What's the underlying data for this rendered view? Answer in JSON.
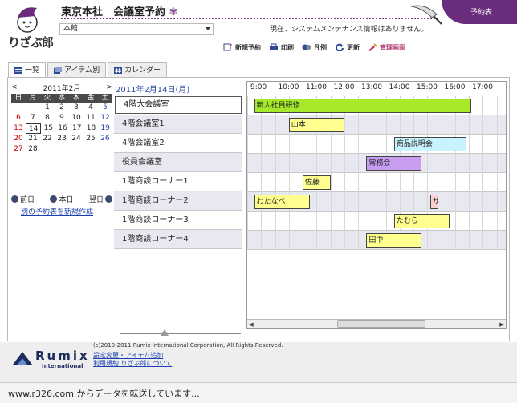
{
  "header": {
    "logo_text": "りざぶ郎",
    "title": "東京本社　会議室予約",
    "place_value": "本館",
    "system_message": "現在、システムメンテナンス情報はありません。",
    "reserve_tag": "予約表"
  },
  "toolbar": [
    {
      "label": "新規予約",
      "icon": "new-reservation-icon",
      "color": "#2d4a9a"
    },
    {
      "label": "印刷",
      "icon": "print-icon",
      "color": "#2d4a9a"
    },
    {
      "label": "凡例",
      "icon": "legend-icon",
      "color": "#2d4a9a"
    },
    {
      "label": "更新",
      "icon": "refresh-icon",
      "color": "#2d4a9a"
    },
    {
      "label": "管理画面",
      "icon": "admin-icon",
      "color": "#c04070"
    }
  ],
  "tabs": [
    {
      "label": "一覧",
      "icon": "list-icon",
      "active": true
    },
    {
      "label": "アイテム別",
      "icon": "item-icon",
      "active": false
    },
    {
      "label": "カレンダー",
      "icon": "calendar-icon",
      "active": false
    }
  ],
  "calendar": {
    "month_label": "2011年2月",
    "prev": "<",
    "next": ">",
    "dow": [
      "日",
      "月",
      "火",
      "水",
      "木",
      "金",
      "土"
    ],
    "weeks": [
      [
        "",
        "",
        "1",
        "2",
        "3",
        "4",
        "5"
      ],
      [
        "6",
        "7",
        "8",
        "9",
        "10",
        "11",
        "12"
      ],
      [
        "13",
        "14",
        "15",
        "16",
        "17",
        "18",
        "19"
      ],
      [
        "20",
        "21",
        "22",
        "23",
        "24",
        "25",
        "26"
      ],
      [
        "27",
        "28",
        "",
        "",
        "",
        "",
        ""
      ]
    ],
    "selected_day": "14"
  },
  "day_nav": {
    "prev": "前日",
    "today": "本日",
    "next": "翌日"
  },
  "new_table_link": "別の予約表を新規作成",
  "current_date": "2011年2月14日(月)",
  "rooms": [
    "4階大会議室",
    "4階会議室1",
    "4階会議室2",
    "役員会議室",
    "1階商談コーナー1",
    "1階商談コーナー2",
    "1階商談コーナー3",
    "1階商談コーナー4"
  ],
  "hours": [
    "9:00",
    "10:00",
    "11:00",
    "12:00",
    "13:00",
    "14:00",
    "15:00",
    "16:00",
    "17:00"
  ],
  "events": [
    {
      "room": 0,
      "start": 9.25,
      "end": 17.1,
      "title": "新人社員研修",
      "color": "#a6e82a"
    },
    {
      "room": 1,
      "start": 10.5,
      "end": 12.5,
      "title": "山本",
      "color": "#ffff90"
    },
    {
      "room": 2,
      "start": 14.3,
      "end": 16.9,
      "title": "商品説明会",
      "color": "#c8f4ff"
    },
    {
      "room": 3,
      "start": 13.3,
      "end": 15.3,
      "title": "常務会",
      "color": "#c89cf0"
    },
    {
      "room": 4,
      "start": 11.0,
      "end": 12.0,
      "title": "佐藤",
      "color": "#ffff90"
    },
    {
      "room": 5,
      "start": 9.25,
      "end": 11.25,
      "title": "わたなべ",
      "color": "#ffff90"
    },
    {
      "room": 5,
      "start": 15.6,
      "end": 15.9,
      "title": "サ",
      "color": "#ffd0d0"
    },
    {
      "room": 6,
      "start": 14.3,
      "end": 16.3,
      "title": "たむら",
      "color": "#ffff90"
    },
    {
      "room": 7,
      "start": 13.3,
      "end": 15.3,
      "title": "田中",
      "color": "#ffff90"
    }
  ],
  "footer": {
    "brand": "Rumix",
    "brand_sub": "International",
    "copyright": "(c)2010-2011 Rumix International Corporation, All Rights Reserved.",
    "link1": "設定変更・アイテム追加",
    "link2": "利用規約 りざぶ郎について"
  },
  "status_text": "www.r326.com からデータを転送しています..."
}
